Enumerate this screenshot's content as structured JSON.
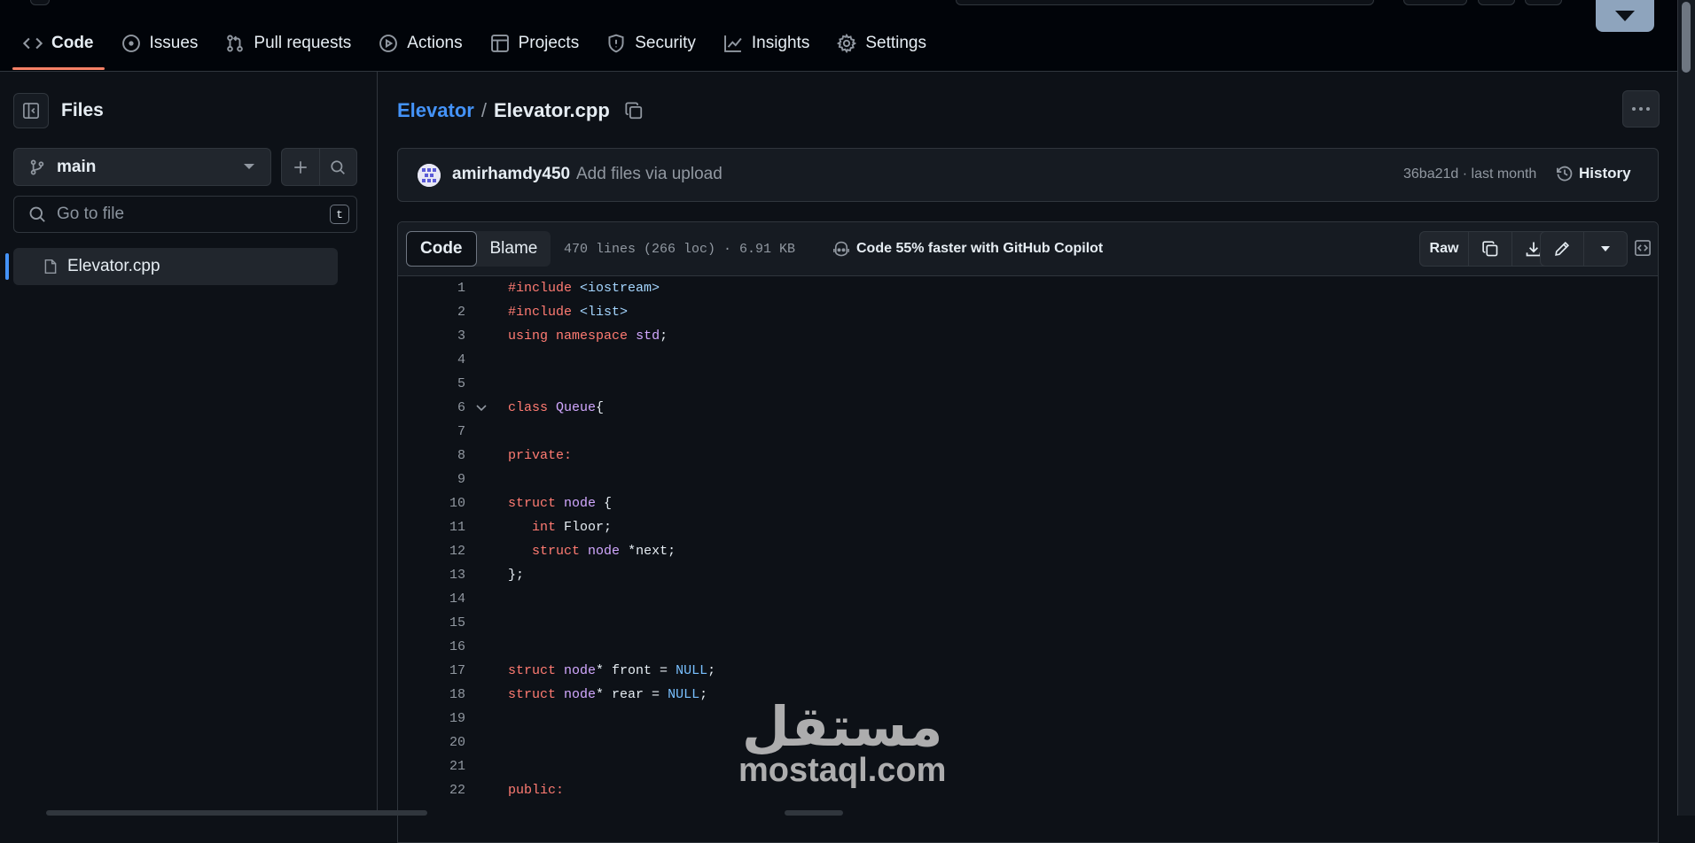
{
  "nav": {
    "tabs": [
      {
        "label": "Code",
        "icon": "code-icon"
      },
      {
        "label": "Issues",
        "icon": "issue-icon"
      },
      {
        "label": "Pull requests",
        "icon": "pull-request-icon"
      },
      {
        "label": "Actions",
        "icon": "play-icon"
      },
      {
        "label": "Projects",
        "icon": "table-icon"
      },
      {
        "label": "Security",
        "icon": "shield-icon"
      },
      {
        "label": "Insights",
        "icon": "graph-icon"
      },
      {
        "label": "Settings",
        "icon": "gear-icon"
      }
    ],
    "active_tab": "Code"
  },
  "sidebar": {
    "title": "Files",
    "branch": "main",
    "search_placeholder": "Go to file",
    "search_shortcut": "t",
    "files": [
      {
        "name": "Elevator.cpp",
        "selected": true
      }
    ]
  },
  "breadcrumb": {
    "repo": "Elevator",
    "separator": "/",
    "file": "Elevator.cpp"
  },
  "commit": {
    "author": "amirhamdy450",
    "message": "Add files via upload",
    "meta": "36ba21d · last month",
    "history_label": "History"
  },
  "file_header": {
    "tabs": [
      "Code",
      "Blame"
    ],
    "active_tab": "Code",
    "info": "470 lines (266 loc) · 6.91 KB",
    "copilot": "Code 55% faster with GitHub Copilot",
    "raw_label": "Raw"
  },
  "code_lines": [
    {
      "n": "1",
      "tokens": [
        {
          "k": "k",
          "v": "#include"
        },
        {
          "k": "s",
          "v": " <iostream>"
        }
      ]
    },
    {
      "n": "2",
      "tokens": [
        {
          "k": "k",
          "v": "#include"
        },
        {
          "k": "s",
          "v": " <list>"
        }
      ]
    },
    {
      "n": "3",
      "tokens": [
        {
          "k": "k",
          "v": "using"
        },
        {
          "k": "",
          "v": " "
        },
        {
          "k": "k",
          "v": "namespace"
        },
        {
          "k": "",
          "v": " "
        },
        {
          "k": "t",
          "v": "std"
        },
        {
          "k": "",
          "v": ";"
        }
      ]
    },
    {
      "n": "4",
      "tokens": []
    },
    {
      "n": "5",
      "tokens": []
    },
    {
      "n": "6",
      "fold": true,
      "tokens": [
        {
          "k": "k",
          "v": "class"
        },
        {
          "k": "",
          "v": " "
        },
        {
          "k": "t",
          "v": "Queue"
        },
        {
          "k": "",
          "v": "{"
        }
      ]
    },
    {
      "n": "7",
      "tokens": []
    },
    {
      "n": "8",
      "tokens": [
        {
          "k": "k",
          "v": "private:"
        }
      ]
    },
    {
      "n": "9",
      "tokens": []
    },
    {
      "n": "10",
      "tokens": [
        {
          "k": "k",
          "v": "struct"
        },
        {
          "k": "",
          "v": " "
        },
        {
          "k": "t",
          "v": "node"
        },
        {
          "k": "",
          "v": " {"
        }
      ]
    },
    {
      "n": "11",
      "tokens": [
        {
          "k": "",
          "v": "   "
        },
        {
          "k": "k",
          "v": "int"
        },
        {
          "k": "",
          "v": " Floor;"
        }
      ]
    },
    {
      "n": "12",
      "tokens": [
        {
          "k": "",
          "v": "   "
        },
        {
          "k": "k",
          "v": "struct"
        },
        {
          "k": "",
          "v": " "
        },
        {
          "k": "t",
          "v": "node"
        },
        {
          "k": "",
          "v": " *next;"
        }
      ]
    },
    {
      "n": "13",
      "tokens": [
        {
          "k": "",
          "v": "};"
        }
      ]
    },
    {
      "n": "14",
      "tokens": []
    },
    {
      "n": "15",
      "tokens": []
    },
    {
      "n": "16",
      "tokens": []
    },
    {
      "n": "17",
      "tokens": [
        {
          "k": "k",
          "v": "struct"
        },
        {
          "k": "",
          "v": " "
        },
        {
          "k": "t",
          "v": "node"
        },
        {
          "k": "",
          "v": "* front = "
        },
        {
          "k": "c",
          "v": "NULL"
        },
        {
          "k": "",
          "v": ";"
        }
      ]
    },
    {
      "n": "18",
      "tokens": [
        {
          "k": "k",
          "v": "struct"
        },
        {
          "k": "",
          "v": " "
        },
        {
          "k": "t",
          "v": "node"
        },
        {
          "k": "",
          "v": "* rear = "
        },
        {
          "k": "c",
          "v": "NULL"
        },
        {
          "k": "",
          "v": ";"
        }
      ]
    },
    {
      "n": "19",
      "tokens": []
    },
    {
      "n": "20",
      "tokens": []
    },
    {
      "n": "21",
      "tokens": []
    },
    {
      "n": "22",
      "tokens": [
        {
          "k": "k",
          "v": "public:"
        }
      ]
    }
  ],
  "watermark": {
    "arabic": "مستقل",
    "latin": "mostaql.com"
  },
  "colors": {
    "background": "#0d1117",
    "accent_link": "#4493f8",
    "active_tab_underline": "#f78166",
    "keyword": "#ff7b72",
    "type": "#d2a8ff",
    "constant": "#79c0ff"
  }
}
